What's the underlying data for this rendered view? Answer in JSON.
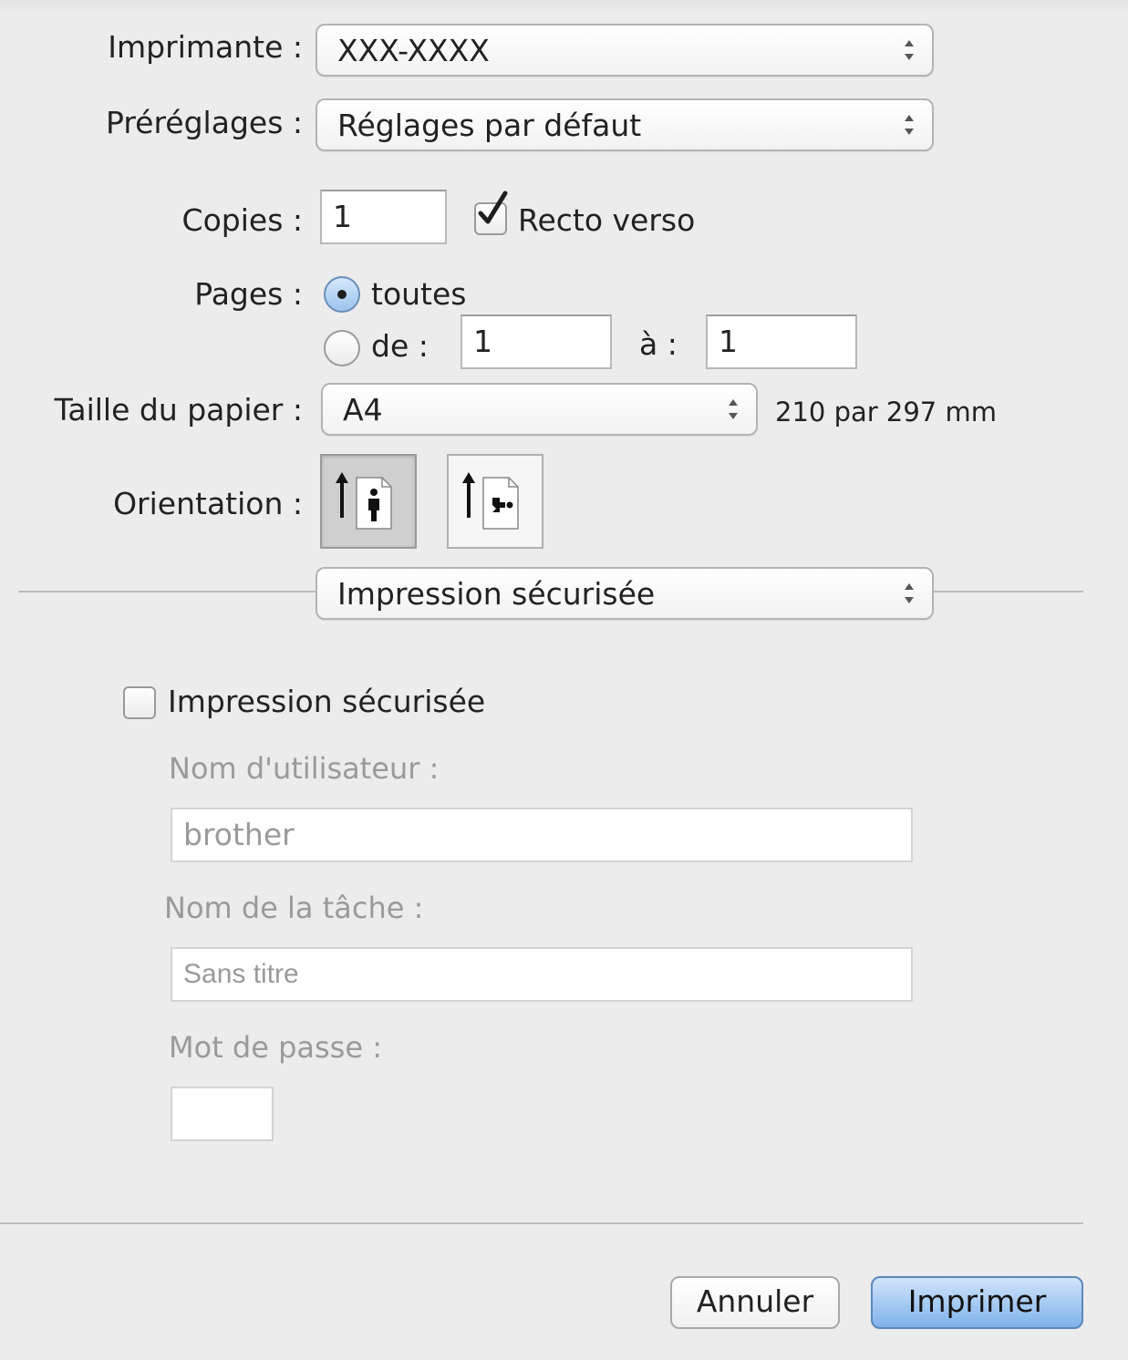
{
  "printer": {
    "label": "Imprimante :",
    "value": "XXX-XXXX"
  },
  "presets": {
    "label": "Préréglages :",
    "value": "Réglages par défaut"
  },
  "copies": {
    "label": "Copies :",
    "value": "1",
    "duplex_label": "Recto verso",
    "duplex_checked": true
  },
  "pages": {
    "label": "Pages :",
    "all_label": "toutes",
    "range_label": "de :",
    "from_value": "1",
    "to_label": "à :",
    "to_value": "1",
    "selected": "all"
  },
  "paper_size": {
    "label": "Taille du papier :",
    "value": "A4",
    "dimensions": "210 par 297 mm"
  },
  "orientation": {
    "label": "Orientation :",
    "selected": "portrait",
    "icons": [
      "portrait-icon",
      "landscape-icon"
    ]
  },
  "section_menu": {
    "value": "Impression sécurisée"
  },
  "secure_print": {
    "checkbox_label": "Impression sécurisée",
    "checked": false,
    "username_label": "Nom d'utilisateur :",
    "username_value": "brother",
    "job_name_label": "Nom de la tâche :",
    "job_name_value": "Sans titre",
    "password_label": "Mot de passe :",
    "password_value": ""
  },
  "buttons": {
    "cancel": "Annuler",
    "print": "Imprimer"
  },
  "colors": {
    "background": "#ececec",
    "primary_button": "#7fb2ea",
    "disabled_text": "#9a9a9a"
  }
}
